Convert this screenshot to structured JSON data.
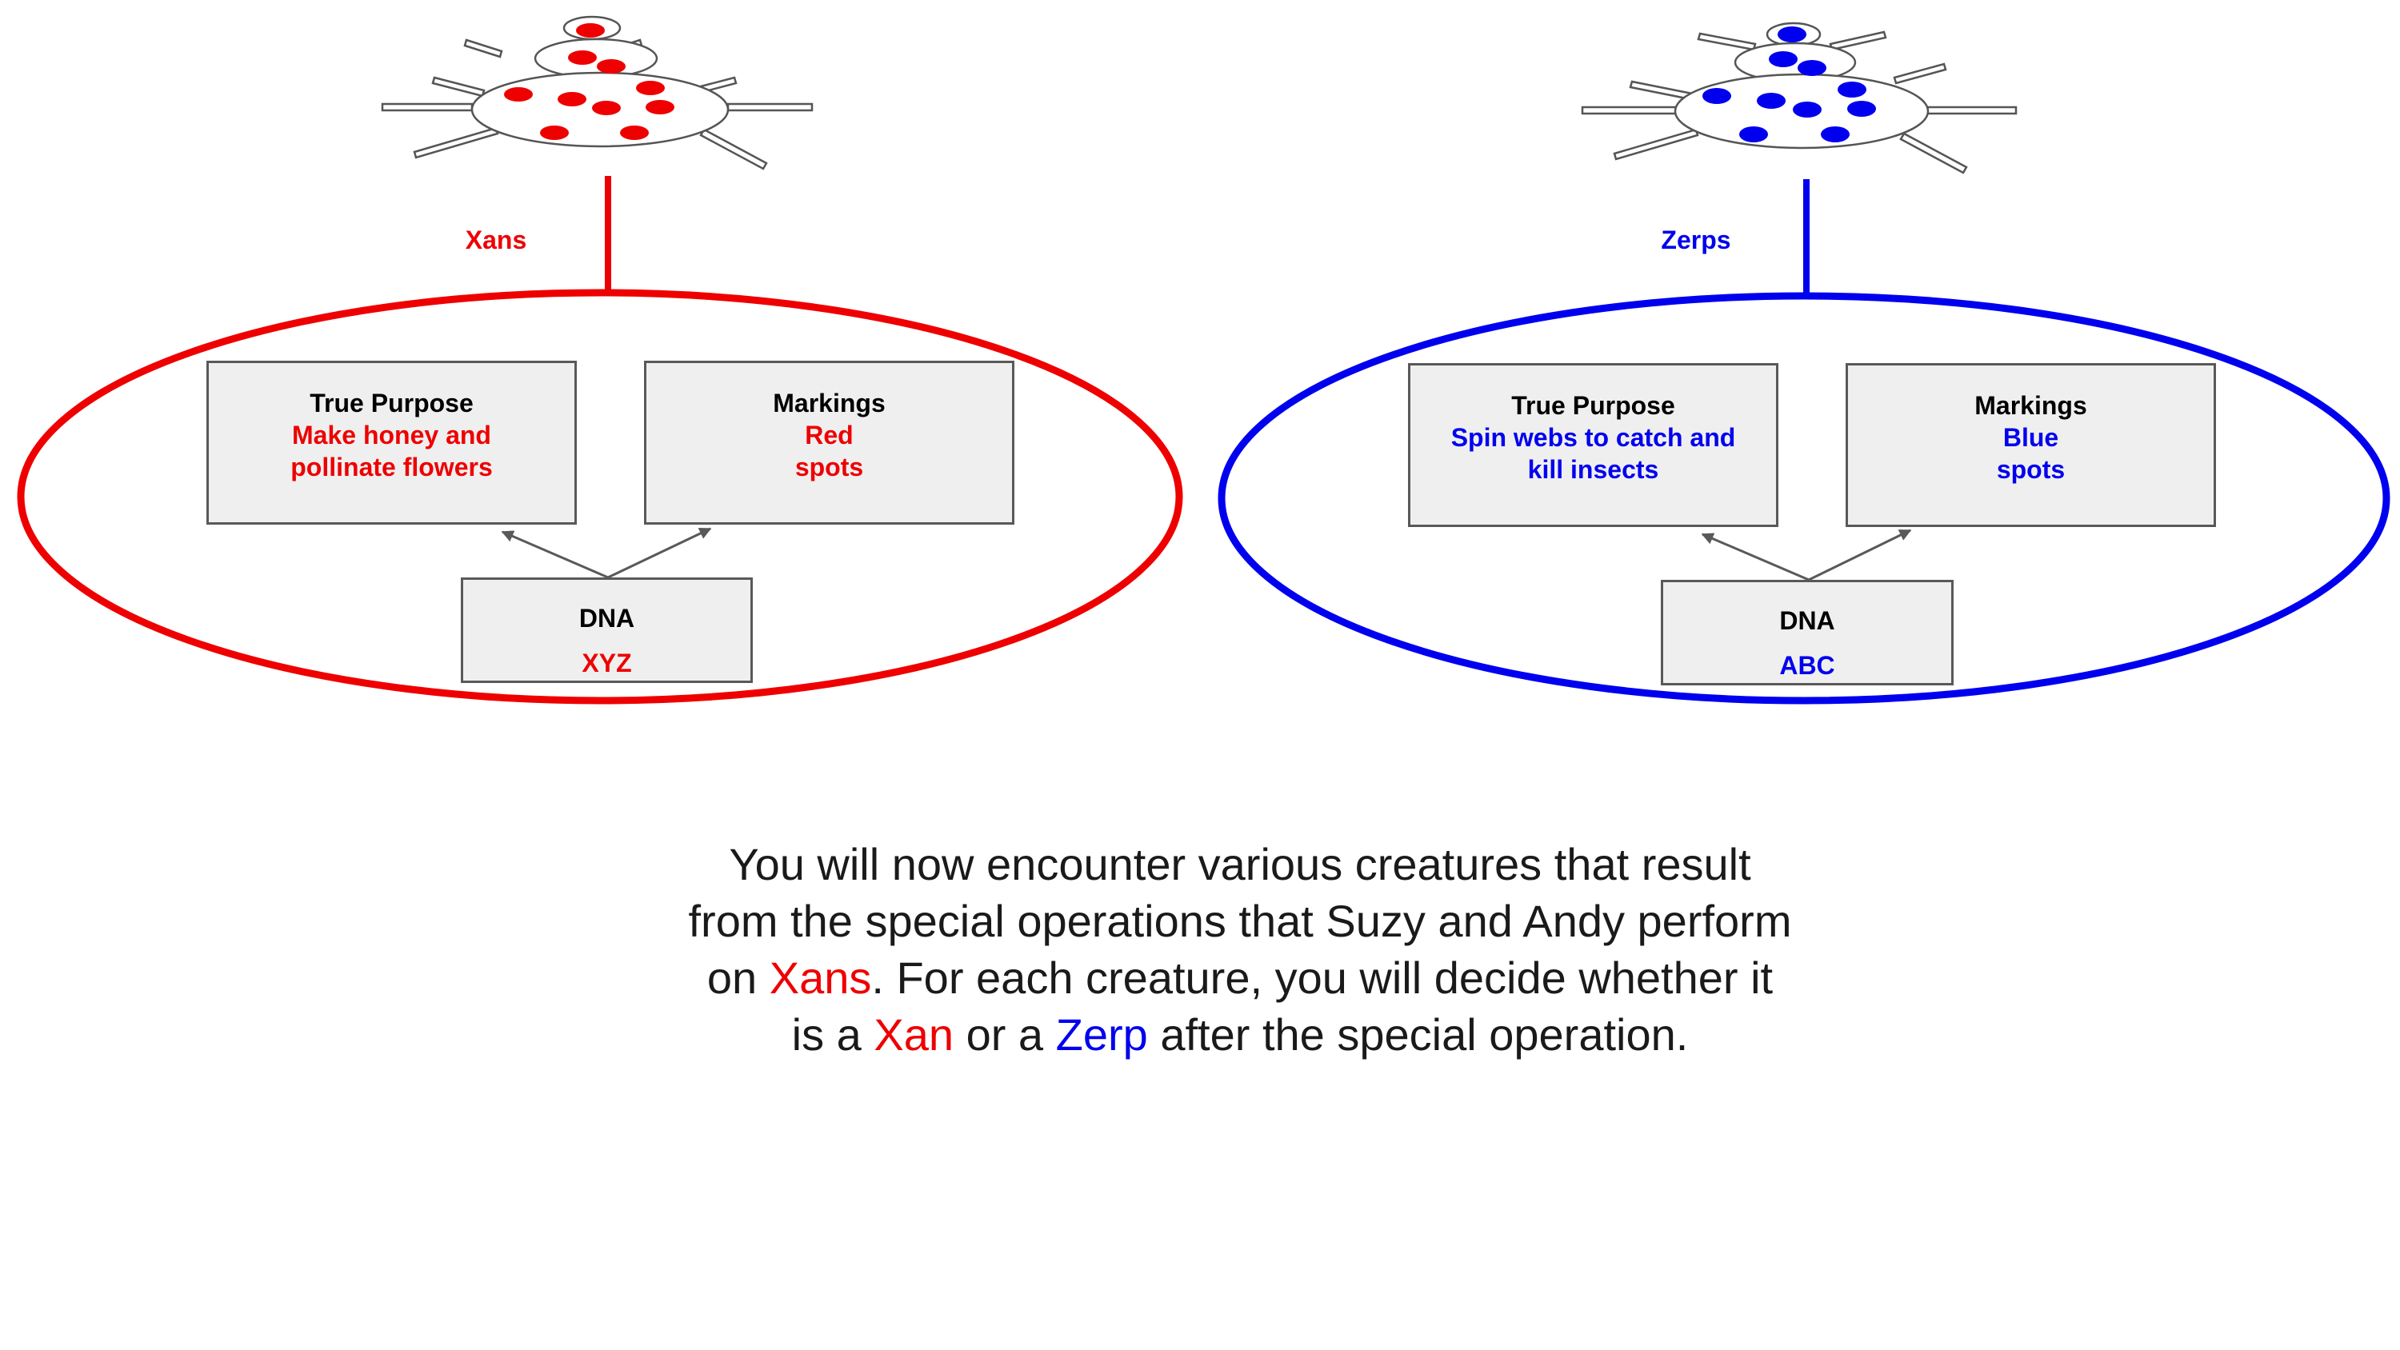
{
  "colors": {
    "xan": "#ee0000",
    "zerp": "#0000ee",
    "text": "#1a1a1a",
    "box_fill": "#efefef",
    "box_border": "#595959"
  },
  "left_group": {
    "label": "Xans",
    "color": "#ee0000",
    "true_purpose": {
      "title": "True Purpose",
      "value": "Make honey and\npollinate flowers"
    },
    "markings": {
      "title": "Markings",
      "value": "Red\nspots"
    },
    "dna": {
      "title": "DNA",
      "value": "XYZ"
    }
  },
  "right_group": {
    "label": "Zerps",
    "color": "#0000ee",
    "true_purpose": {
      "title": "True Purpose",
      "value": "Spin webs to catch and\nkill insects"
    },
    "markings": {
      "title": "Markings",
      "value": "Blue\nspots"
    },
    "dna": {
      "title": "DNA",
      "value": "ABC"
    }
  },
  "instructions": {
    "part1": "You will now encounter various creatures that result from the special operations that Suzy and Andy perform on ",
    "xans": "Xans",
    "part2": ". For each creature, you will decide whether it is a ",
    "xan": "Xan",
    "part3": " or a ",
    "zerp": "Zerp",
    "part4": " after the special operation."
  }
}
